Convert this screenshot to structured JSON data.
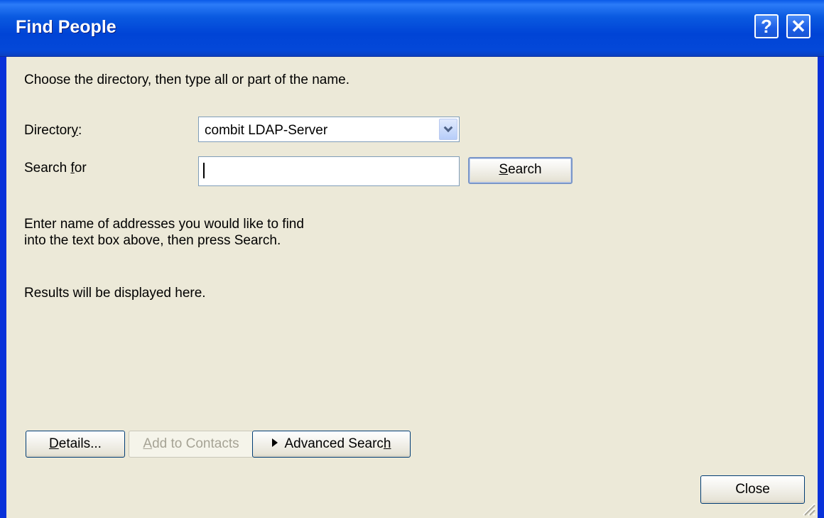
{
  "window": {
    "title": "Find People",
    "help_glyph": "?",
    "close_glyph": "✕"
  },
  "instructions": "Choose the directory, then type all or part of the name.",
  "directory": {
    "label_prefix": "Director",
    "label_underlined": "y",
    "label_suffix": ":",
    "selected": "combit LDAP-Server"
  },
  "search_for": {
    "label_prefix": "Search ",
    "label_underlined": "f",
    "label_suffix": "or",
    "value": ""
  },
  "search_button": {
    "underlined": "S",
    "rest": "earch"
  },
  "hint": {
    "line1": "Enter name of addresses you would like to find",
    "line2": "into the text box above, then press Search."
  },
  "results_text": "Results will be displayed here.",
  "details_button": {
    "underlined": "D",
    "rest": "etails..."
  },
  "add_contacts_button": {
    "underlined": "A",
    "rest": "dd to Contacts"
  },
  "advanced_search_button": {
    "prefix": "Advanced Searc",
    "underlined": "h"
  },
  "close_button": "Close"
}
